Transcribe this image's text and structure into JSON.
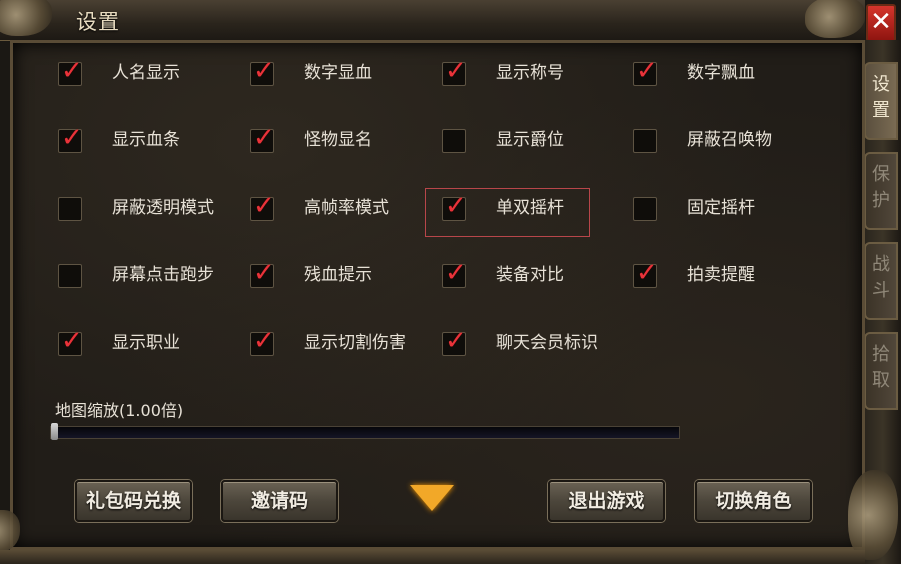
{
  "window": {
    "title": "设置",
    "close_label": "✕"
  },
  "side_tabs": [
    {
      "label": "设置",
      "active": true
    },
    {
      "label": "保护",
      "active": false
    },
    {
      "label": "战斗",
      "active": false
    },
    {
      "label": "拾取",
      "active": false
    }
  ],
  "options": [
    {
      "label": "人名显示",
      "checked": true
    },
    {
      "label": "数字显血",
      "checked": true
    },
    {
      "label": "显示称号",
      "checked": true
    },
    {
      "label": "数字飘血",
      "checked": true
    },
    {
      "label": "显示血条",
      "checked": true
    },
    {
      "label": "怪物显名",
      "checked": true
    },
    {
      "label": "显示爵位",
      "checked": false
    },
    {
      "label": "屏蔽召唤物",
      "checked": false
    },
    {
      "label": "屏蔽透明模式",
      "checked": false
    },
    {
      "label": "高帧率模式",
      "checked": true
    },
    {
      "label": "单双摇杆",
      "checked": true,
      "highlighted": true
    },
    {
      "label": "固定摇杆",
      "checked": false
    },
    {
      "label": "屏幕点击跑步",
      "checked": false
    },
    {
      "label": "残血提示",
      "checked": true
    },
    {
      "label": "装备对比",
      "checked": true
    },
    {
      "label": "拍卖提醒",
      "checked": true
    },
    {
      "label": "显示职业",
      "checked": true
    },
    {
      "label": "显示切割伤害",
      "checked": true
    },
    {
      "label": "聊天会员标识",
      "checked": true
    }
  ],
  "check_mark": "✓",
  "map_zoom": {
    "label": "地图缩放(1.00倍)",
    "value": 1.0
  },
  "buttons": {
    "gift_code": "礼包码兑换",
    "invite_code": "邀请码",
    "exit_game": "退出游戏",
    "switch_role": "切换角色"
  },
  "colors": {
    "check": "#e8333a",
    "arrow": "#f2a828",
    "highlight": "#b8464a"
  }
}
